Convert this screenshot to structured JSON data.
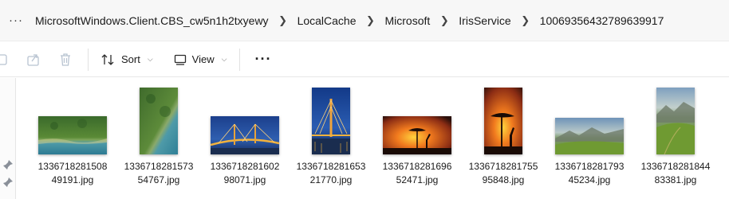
{
  "breadcrumb": {
    "more": "···",
    "items": [
      {
        "label": "MicrosoftWindows.Client.CBS_cw5n1h2txyewy"
      },
      {
        "label": "LocalCache"
      },
      {
        "label": "Microsoft"
      },
      {
        "label": "IrisService"
      },
      {
        "label": "10069356432789639917"
      }
    ]
  },
  "toolbar": {
    "sort_label": "Sort",
    "view_label": "View",
    "more_label": "···",
    "icons": [
      "share-icon",
      "delete-icon",
      "sort-icon",
      "view-icon"
    ]
  },
  "files": [
    {
      "line1": "1336718281508",
      "line2": "49191.jpg",
      "thumb": "aerial-forest-coast"
    },
    {
      "line1": "1336718281573",
      "line2": "54767.jpg",
      "thumb": "aerial-forest-water"
    },
    {
      "line1": "1336718281602",
      "line2": "98071.jpg",
      "thumb": "bridge-night"
    },
    {
      "line1": "1336718281653",
      "line2": "21770.jpg",
      "thumb": "bridge-tower-night"
    },
    {
      "line1": "1336718281696",
      "line2": "52471.jpg",
      "thumb": "acacia-sunset-giraffe"
    },
    {
      "line1": "1336718281755",
      "line2": "95848.jpg",
      "thumb": "acacia-sunset-giraffe-portrait"
    },
    {
      "line1": "1336718281793",
      "line2": "45234.jpg",
      "thumb": "mountain-valley"
    },
    {
      "line1": "1336718281844",
      "line2": "83381.jpg",
      "thumb": "mountain-valley-portrait"
    }
  ]
}
